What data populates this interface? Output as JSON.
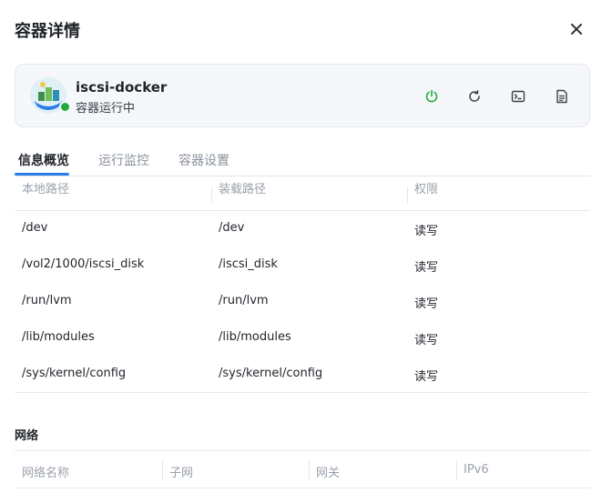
{
  "dialog": {
    "title": "容器详情"
  },
  "container": {
    "name": "iscsi-docker",
    "status": "容器运行中",
    "status_color": "#1faa3a"
  },
  "actions": [
    {
      "icon": "power-icon"
    },
    {
      "icon": "restart-icon"
    },
    {
      "icon": "terminal-icon"
    },
    {
      "icon": "log-icon"
    }
  ],
  "tabs": [
    {
      "label": "信息概览",
      "active": true
    },
    {
      "label": "运行监控",
      "active": false
    },
    {
      "label": "容器设置",
      "active": false
    }
  ],
  "volumes": {
    "columns": [
      "本地路径",
      "装载路径",
      "权限"
    ],
    "rows": [
      {
        "local": "/dev",
        "mount": "/dev",
        "permission": "读写"
      },
      {
        "local": "/vol2/1000/iscsi_disk",
        "mount": "/iscsi_disk",
        "permission": "读写"
      },
      {
        "local": "/run/lvm",
        "mount": "/run/lvm",
        "permission": "读写"
      },
      {
        "local": "/lib/modules",
        "mount": "/lib/modules",
        "permission": "读写"
      },
      {
        "local": "/sys/kernel/config",
        "mount": "/sys/kernel/config",
        "permission": "读写"
      }
    ]
  },
  "network": {
    "title": "网络",
    "columns": [
      "网络名称",
      "子网",
      "网关",
      "IPv6"
    ]
  },
  "colors": {
    "accent": "#2b7de9",
    "running": "#1faa3a"
  }
}
